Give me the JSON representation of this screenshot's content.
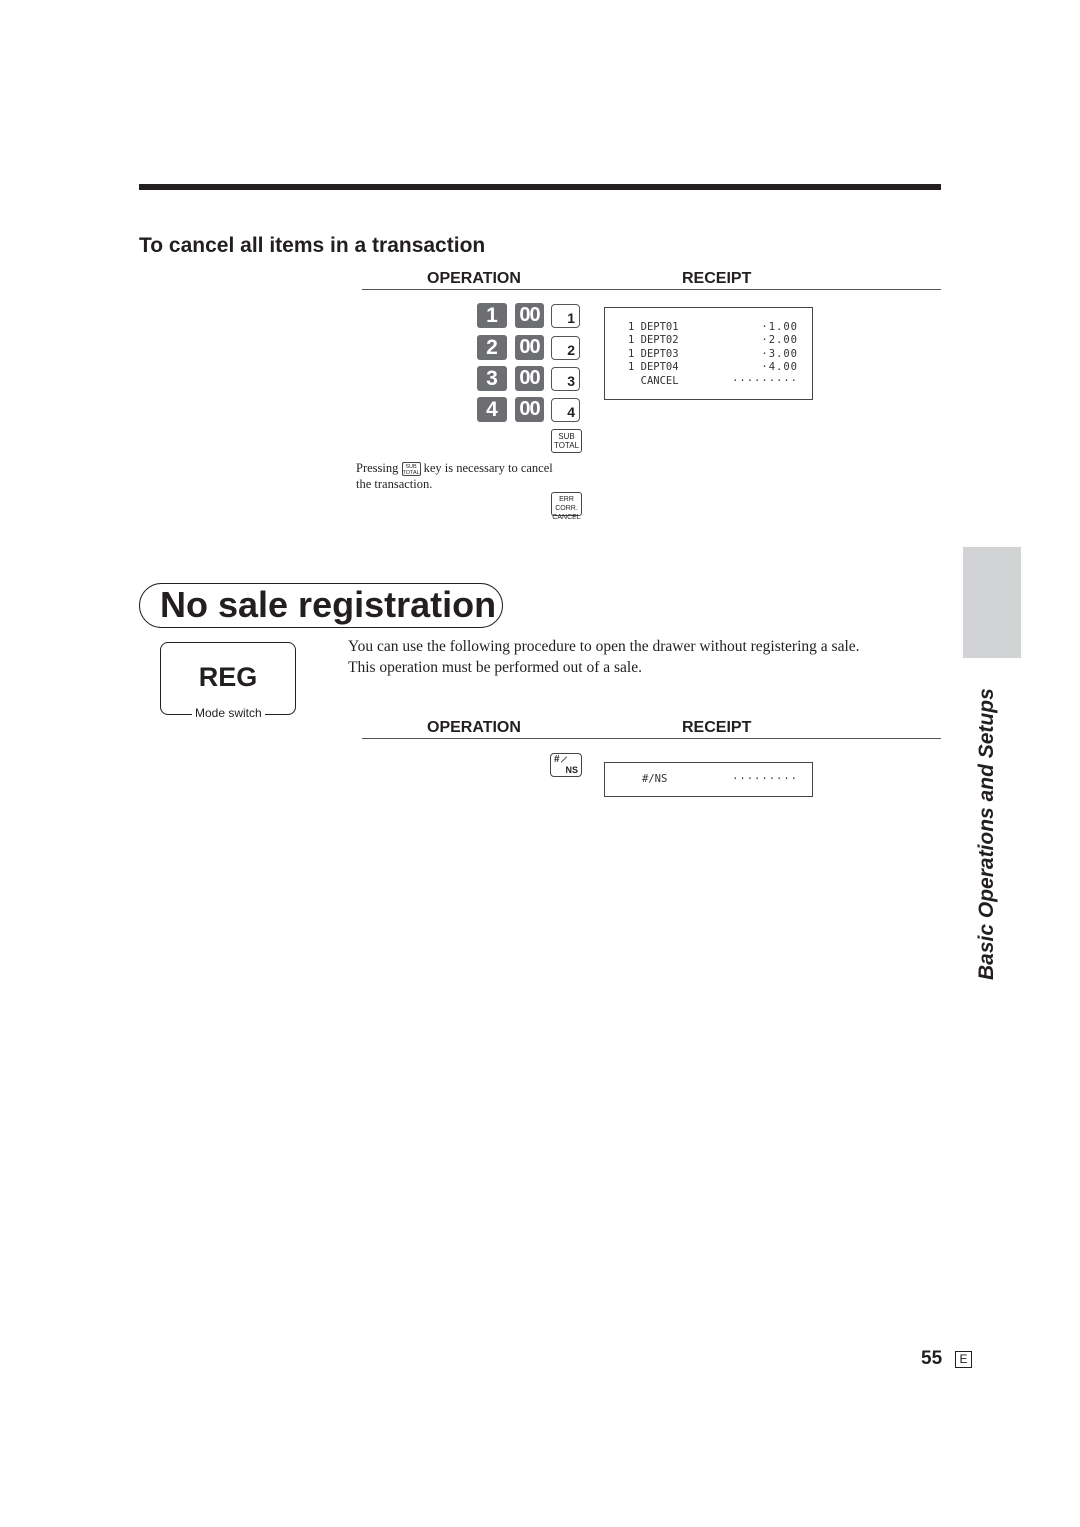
{
  "section1": {
    "heading": "To cancel all items in a transaction",
    "operation_header": "OPERATION",
    "receipt_header": "RECEIPT",
    "key_rows": [
      {
        "digit": "1",
        "zeros": "00",
        "dept": "1"
      },
      {
        "digit": "2",
        "zeros": "00",
        "dept": "2"
      },
      {
        "digit": "3",
        "zeros": "00",
        "dept": "3"
      },
      {
        "digit": "4",
        "zeros": "00",
        "dept": "4"
      }
    ],
    "subtotal_key": {
      "line1": "SUB",
      "line2": "TOTAL"
    },
    "note_pre": "Pressing",
    "note_post": "key is necessary to cancel",
    "note_line2": "the transaction.",
    "cancel_key": {
      "line1": "ERR CORR.",
      "line2": "CANCEL"
    },
    "receipt_rows": [
      {
        "left": "1 DEPT01",
        "right": "·1.00"
      },
      {
        "left": "1 DEPT02",
        "right": "·2.00"
      },
      {
        "left": "1 DEPT03",
        "right": "·3.00"
      },
      {
        "left": "1 DEPT04",
        "right": "·4.00"
      },
      {
        "left": "  CANCEL",
        "right": "·········"
      }
    ]
  },
  "section2": {
    "title": "No sale registration",
    "mode_switch": {
      "value": "REG",
      "label": "Mode switch"
    },
    "body_line1": "You can use the following procedure to open the drawer without registering a sale.",
    "body_line2": "This operation must be performed out of a sale.",
    "operation_header": "OPERATION",
    "receipt_header": "RECEIPT",
    "ns_key": {
      "top": "#",
      "bottom": "NS"
    },
    "receipt_rows": [
      {
        "left": "#/NS",
        "right": "·········"
      }
    ]
  },
  "sidebar": {
    "tab_color": "#d1d3d4",
    "label": "Basic Operations and Setups"
  },
  "footer": {
    "page_number": "55",
    "language": "E"
  }
}
